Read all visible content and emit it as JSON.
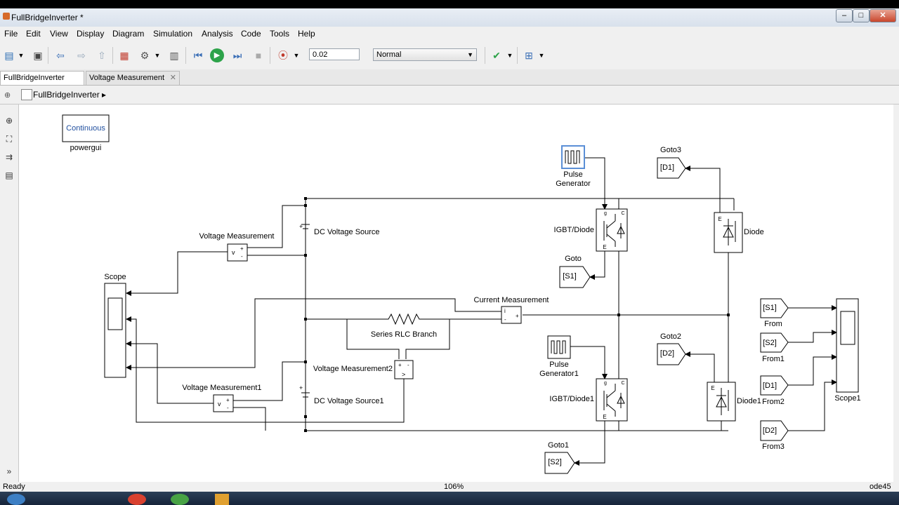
{
  "window": {
    "title": "FullBridgeInverter *",
    "minimize": "–",
    "maximize": "□",
    "close": "✕"
  },
  "menu": [
    "File",
    "Edit",
    "View",
    "Display",
    "Diagram",
    "Simulation",
    "Analysis",
    "Code",
    "Tools",
    "Help"
  ],
  "toolbar": {
    "stop_time": "0.02",
    "sim_mode": "Normal"
  },
  "tabs": [
    {
      "label": "FullBridgeInverter"
    },
    {
      "label": "Voltage Measurement",
      "close": "✕"
    }
  ],
  "breadcrumb": {
    "model": "FullBridgeInverter"
  },
  "blocks": {
    "powergui_mode": "Continuous",
    "powergui": "powergui",
    "pulse_gen": "Pulse",
    "pulse_gen_b": "Generator",
    "pulse_gen1": "Pulse",
    "pulse_gen1_b": "Generator1",
    "goto3": "Goto3",
    "goto3_tag": "[D1]",
    "goto": "Goto",
    "goto_tag": "[S1]",
    "goto2": "Goto2",
    "goto2_tag": "[D2]",
    "goto1": "Goto1",
    "goto1_tag": "[S2]",
    "igbt": "IGBT/Diode",
    "igbt1": "IGBT/Diode1",
    "diode": "Diode",
    "diode1": "Diode1",
    "dc_source": "DC Voltage Source",
    "dc_source1": "DC Voltage Source1",
    "vm": "Voltage Measurement",
    "vm1": "Voltage Measurement1",
    "vm2": "Voltage Measurement2",
    "cm": "Current Measurement",
    "rlc": "Series RLC Branch",
    "scope": "Scope",
    "scope1": "Scope1",
    "from": "From",
    "from_tag": "[S1]",
    "from1": "From1",
    "from1_tag": "[S2]",
    "from2": "From2",
    "from2_tag": "[D1]",
    "from3": "From3",
    "from3_tag": "[D2]",
    "port_v": "v",
    "port_i": "i",
    "port_plus": "+",
    "port_minus": "-",
    "port_gt": ">",
    "port_e": "E",
    "port_c": "C",
    "port_g": "g"
  },
  "status": {
    "left": "Ready",
    "zoom": "106%",
    "solver": "ode45"
  },
  "colors": {
    "accent": "#1f4e9e",
    "selection": "#5b8fd6",
    "run_green": "#2da34a",
    "record_red": "#c0392b"
  }
}
